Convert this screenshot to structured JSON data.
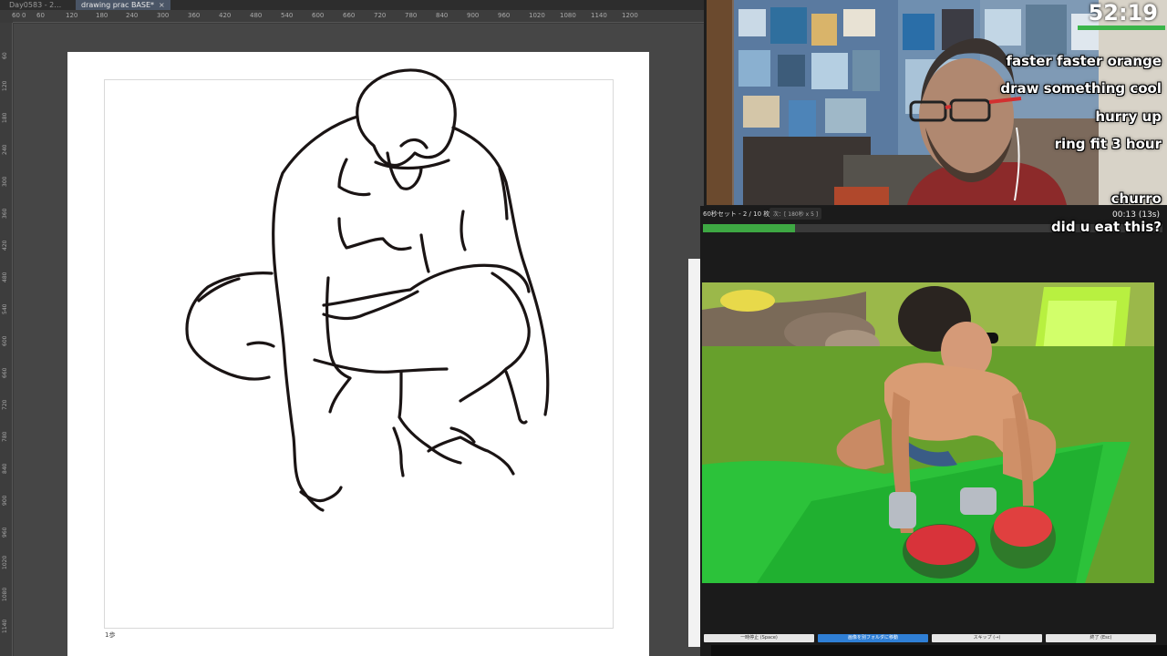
{
  "drawing_app": {
    "tabs": [
      {
        "label": "Day0583 - 2…"
      },
      {
        "label": "drawing prac BASE*",
        "close": "×"
      }
    ],
    "ruler_h_ticks": [
      "60",
      "0",
      "60",
      "120",
      "180",
      "240",
      "300",
      "360",
      "420",
      "480",
      "540",
      "600",
      "660",
      "720",
      "780",
      "840",
      "900",
      "960",
      "1020",
      "1080",
      "1140",
      "1200"
    ],
    "ruler_v_ticks": [
      "60",
      "120",
      "180",
      "240",
      "300",
      "360",
      "420",
      "480",
      "540",
      "600",
      "660",
      "720",
      "780",
      "840",
      "900",
      "960",
      "1020",
      "1080",
      "1140"
    ],
    "page_label": "1歩"
  },
  "stream": {
    "timer": "52:19",
    "chat": [
      "faster faster orange",
      "draw something cool",
      "hurry up",
      "ring fit 3 hour",
      "churro",
      "did u eat this?"
    ]
  },
  "reference_app": {
    "status": "60秒セット - 2 / 10 枚目",
    "mode": "次：[ 180秒 x 5 ]",
    "time": "00:13 (13s)",
    "progress": 0.2,
    "image_alt": "man in sunglasses squatting over halved watermelon on green mat",
    "buttons": [
      {
        "label": "一時停止 (Space)"
      },
      {
        "label": "画像を別フォルダに移動"
      },
      {
        "label": "スキップ (→)"
      },
      {
        "label": "終了 (Esc)"
      }
    ]
  },
  "colors": {
    "accent_green": "#3ea843",
    "primary_button": "#2f7fd6",
    "active_tab": "#4a5566"
  }
}
